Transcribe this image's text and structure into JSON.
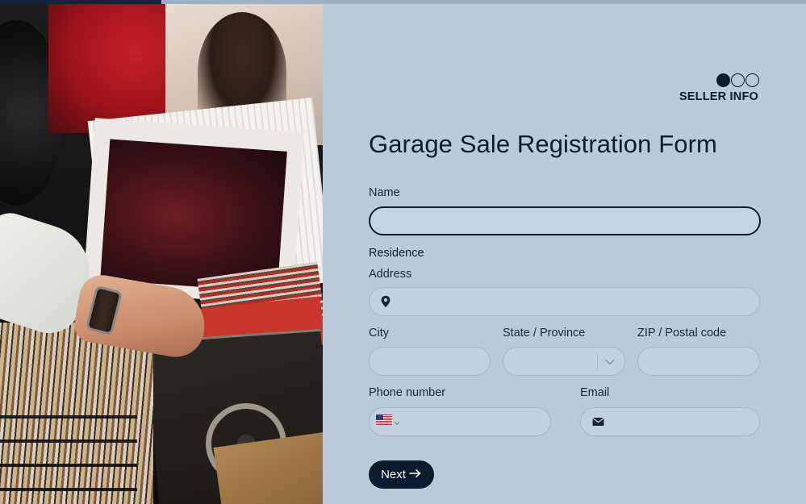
{
  "progress": {
    "fraction": 0.2
  },
  "hero_image": {
    "alt": "Hands browsing vinyl records at a garage sale"
  },
  "steps": {
    "count": 3,
    "active_index": 0,
    "current_label": "SELLER INFO"
  },
  "form": {
    "title": "Garage Sale Registration Form",
    "name": {
      "label": "Name",
      "value": ""
    },
    "residence": {
      "section_label": "Residence",
      "address": {
        "label": "Address",
        "value": "",
        "icon": "map-pin-icon"
      },
      "city": {
        "label": "City",
        "value": ""
      },
      "state": {
        "label": "State / Province",
        "value": "",
        "icon": "chevron-down-icon"
      },
      "zip": {
        "label": "ZIP / Postal code",
        "value": ""
      }
    },
    "phone": {
      "label": "Phone number",
      "value": "",
      "country_icon": "us-flag-icon"
    },
    "email": {
      "label": "Email",
      "value": "",
      "icon": "envelope-icon"
    },
    "next_button": {
      "label": "Next",
      "icon": "arrow-right-icon"
    }
  },
  "colors": {
    "panel_bg": "#bccbdb",
    "accent": "#0c1a30",
    "field_bg": "#c3d2e1",
    "field_border": "#a8b8c9"
  }
}
